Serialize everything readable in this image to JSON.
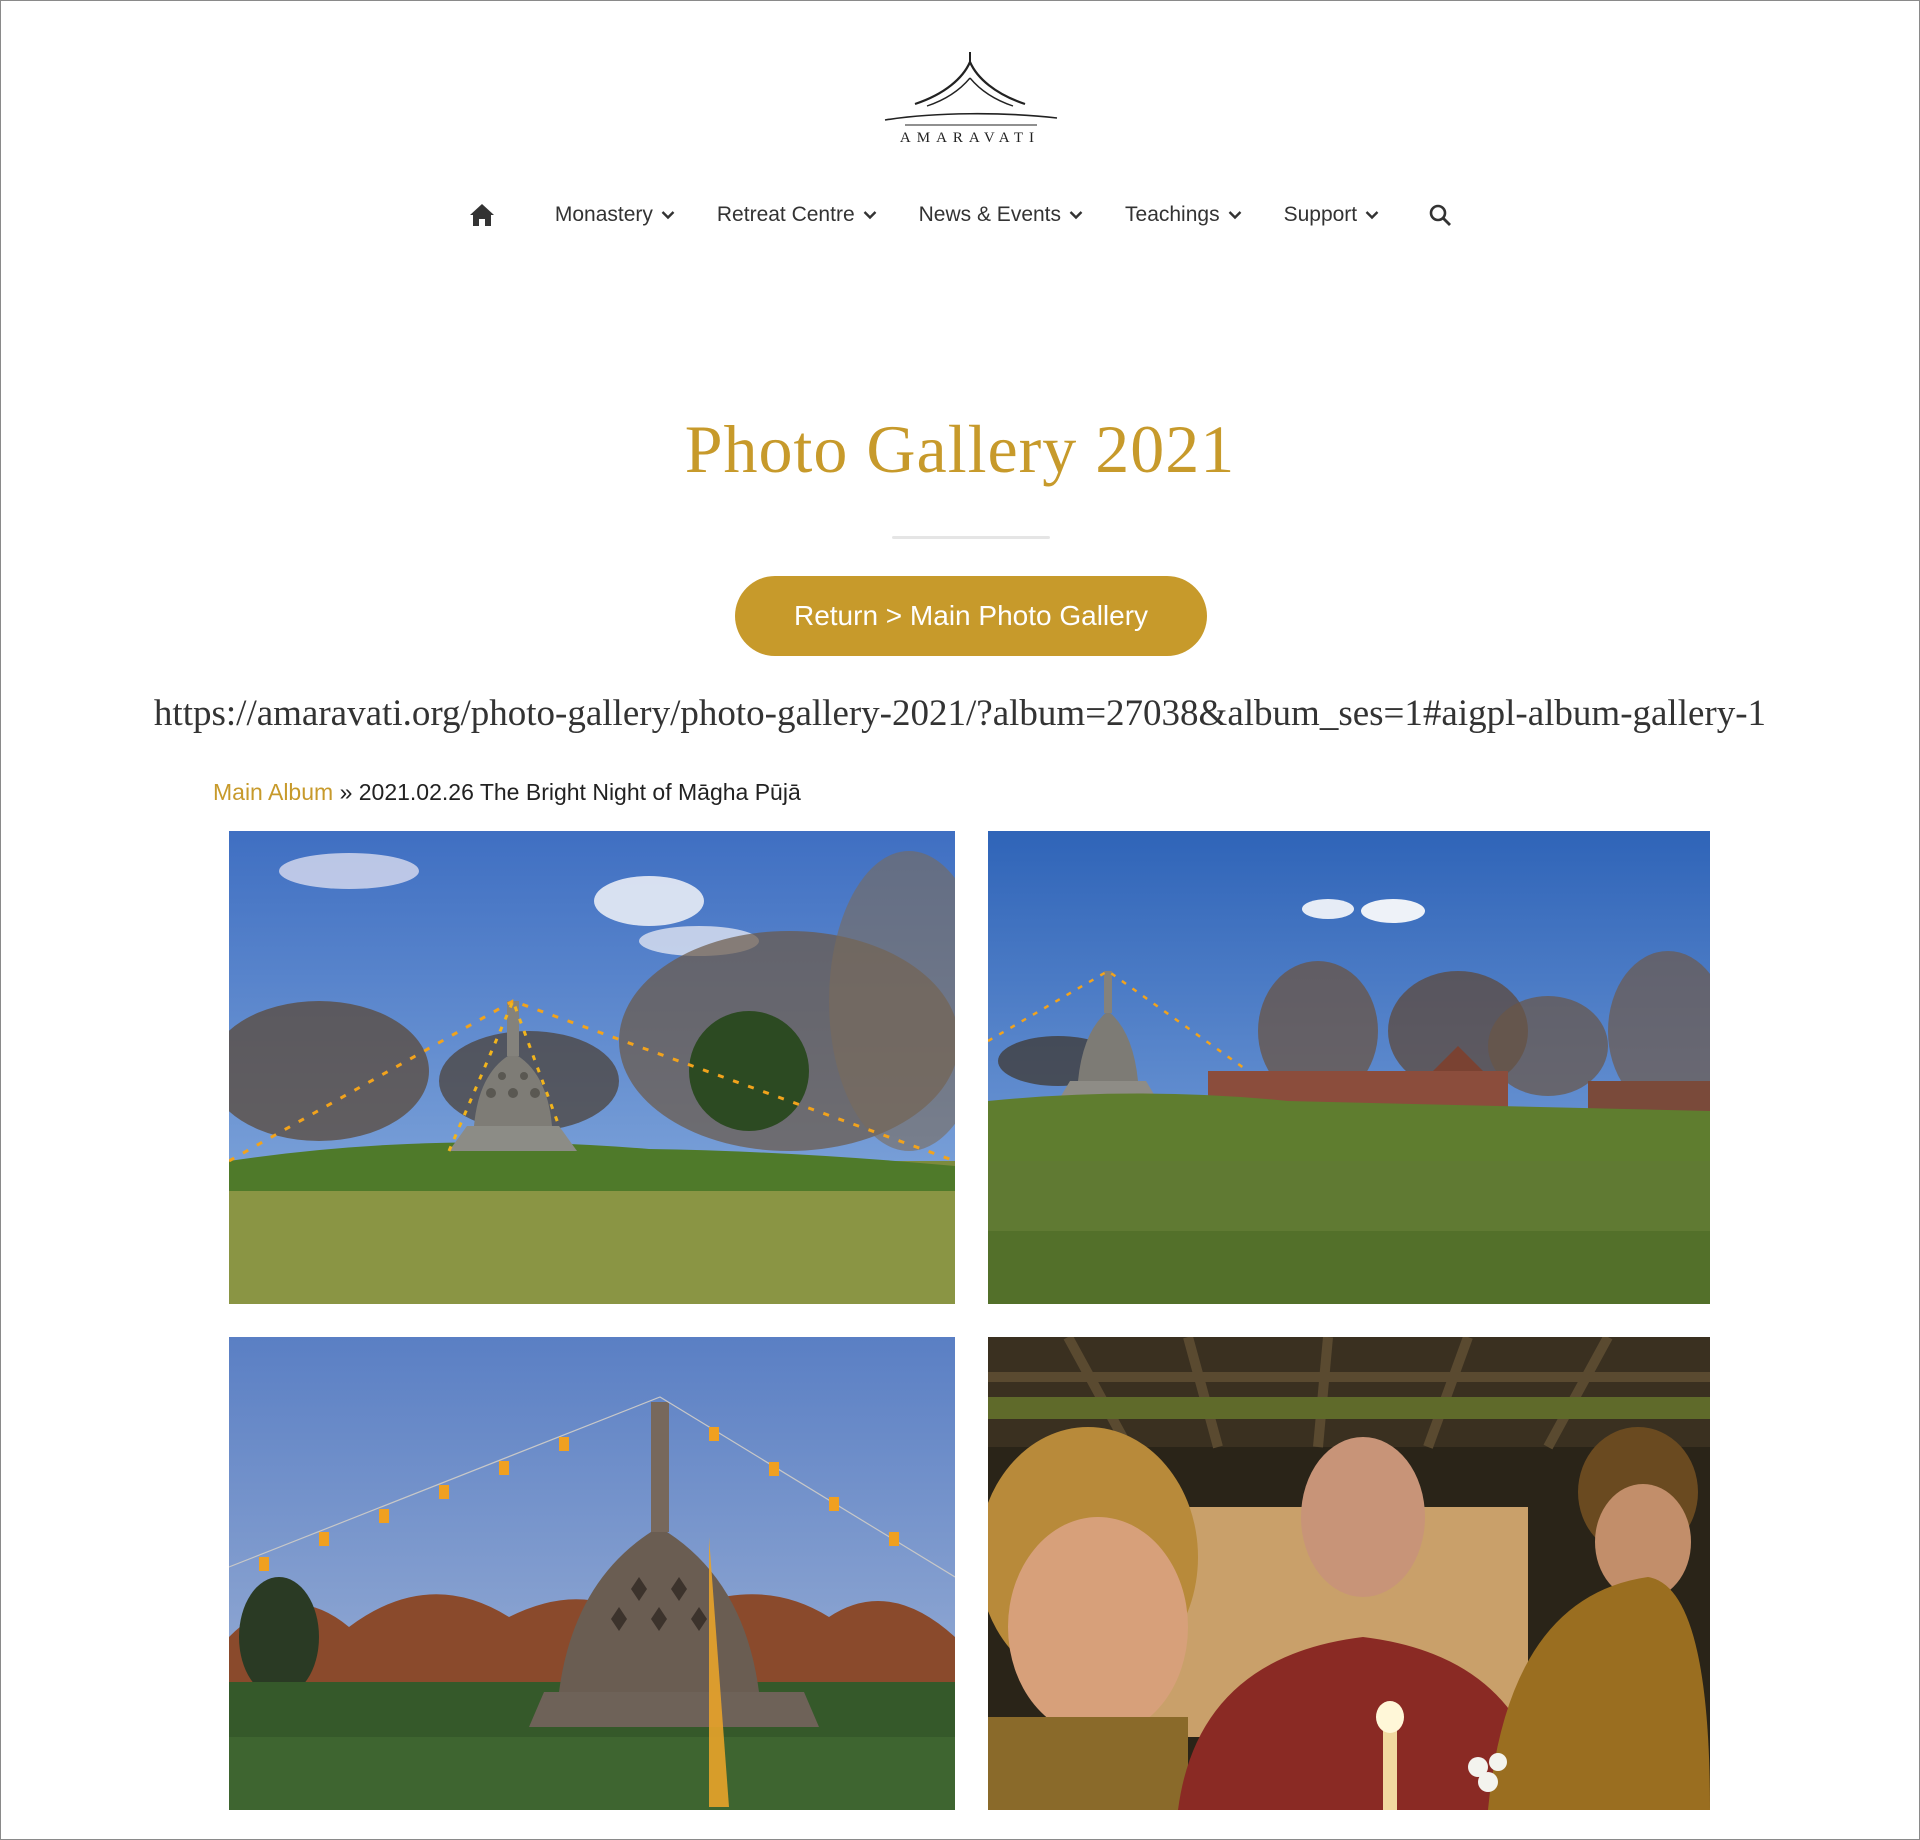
{
  "header": {
    "logo_text": "AMARAVATI",
    "nav": [
      {
        "label": "Monastery"
      },
      {
        "label": "Retreat Centre"
      },
      {
        "label": "News & Events"
      },
      {
        "label": "Teachings"
      },
      {
        "label": "Support"
      }
    ],
    "icons": {
      "home": "home-icon",
      "search": "search-icon",
      "dropdown": "chevron-down-icon"
    }
  },
  "main": {
    "title": "Photo Gallery 2021",
    "return_button": "Return > Main Photo Gallery",
    "url_text": "https://amaravati.org/photo-gallery/photo-gallery-2021/?album=27038&album_ses=1#aigpl-album-gallery-1",
    "breadcrumb": {
      "link": "Main Album",
      "separator": "»",
      "current": "2021.02.26 The Bright Night of Māgha Pūjā"
    }
  },
  "colors": {
    "accent": "#c79a2b",
    "text": "#333333"
  }
}
